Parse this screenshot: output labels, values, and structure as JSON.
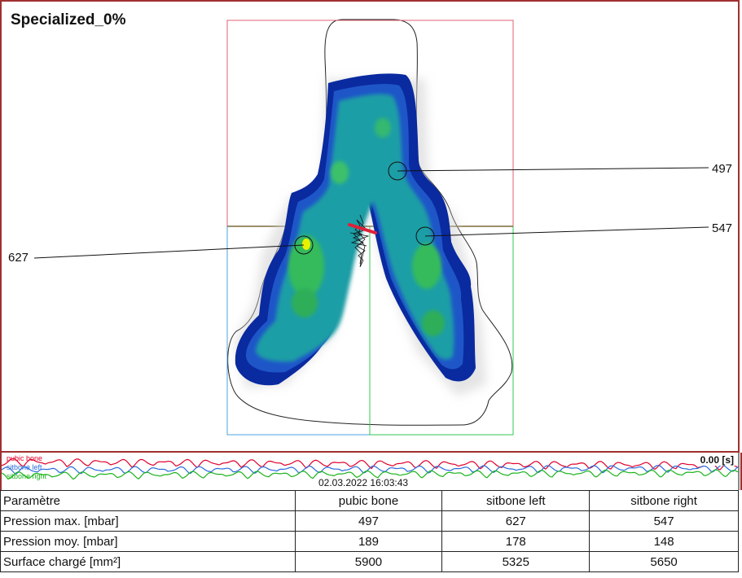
{
  "title": "Specialized_0%",
  "callouts": {
    "pubic_bone": "497",
    "sitbone_left": "627",
    "sitbone_right": "547"
  },
  "trace": {
    "labels": [
      "pubic bone",
      "sitbone left",
      "sitbone right"
    ],
    "time": "0.00 [s]",
    "date": "02.03.2022  16:03:43",
    "colors": {
      "pubic_bone": "#e0002a",
      "sitbone_left": "#2a6bdc",
      "sitbone_right": "#1ab31a"
    }
  },
  "table": {
    "headers": [
      "Paramètre",
      "pubic bone",
      "sitbone left",
      "sitbone right"
    ],
    "rows": [
      [
        "Pression max. [mbar]",
        "497",
        "627",
        "547"
      ],
      [
        "Pression moy. [mbar]",
        "189",
        "178",
        "148"
      ],
      [
        "Surface chargé [mm²]",
        "5900",
        "5325",
        "5650"
      ]
    ]
  }
}
